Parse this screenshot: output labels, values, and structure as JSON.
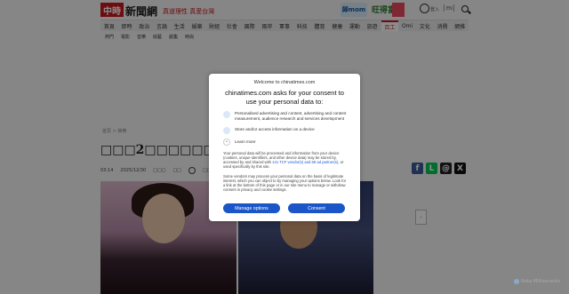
{
  "header": {
    "logo": "中時",
    "site_name": "新聞網",
    "slogan": "真道理性 真愛台灣",
    "promo_1": "歸mom",
    "promo_2": "旺得富",
    "account_label": "登入",
    "header_link": "EN"
  },
  "nav": {
    "items": [
      "首頁",
      "即時",
      "政治",
      "言論",
      "生活",
      "娛樂",
      "財經",
      "社會",
      "國際",
      "兩岸",
      "軍事",
      "科技",
      "體育",
      "健康",
      "運動",
      "旅遊",
      "百工",
      "Omi",
      "文化",
      "消費",
      "網推"
    ],
    "active_index": 16
  },
  "subnav": [
    "熱門",
    "電影",
    "音樂",
    "綜藝",
    "劇集",
    "時尚"
  ],
  "article": {
    "breadcrumb": "首頁 > 娛樂",
    "title": "□□□2□□□□□□□□ □□□□□□□□□",
    "time": "03:14",
    "date": "2025/12/30",
    "author": "□□□",
    "source": "□□",
    "listen_label": "□□□□"
  },
  "share": {
    "facebook": "f",
    "line": "L",
    "threads": "@",
    "x": "X"
  },
  "colors": {
    "brand_red": "#c8161d",
    "consent_blue": "#1a56c8"
  },
  "consent": {
    "top_label": "Welcome to chinatimes.com",
    "heading": "chinatimes.com asks for your consent to use your personal data to:",
    "purposes": [
      {
        "icon": "person-icon",
        "text": "Personalised advertising and content, advertising and content measurement, audience research and services development"
      },
      {
        "icon": "device-icon",
        "text": "Store and/or access information on a device"
      }
    ],
    "learn_more": "Learn more",
    "para_1_a": "Your personal data will be processed and information from your device (cookies, unique identifiers, and other device data) may be stored by, accessed by and shared with ",
    "para_1_link": "141 TCF vendor(s) and 69 ad partner(s)",
    "para_1_b": ", or used specifically by this site.",
    "para_2": "Some vendors may process your personal data on the basis of legitimate interest, which you can object to by managing your options below. Look for a link at the bottom of this page or in our site menu to manage or withdraw consent in privacy and cookie settings.",
    "manage_label": "Manage options",
    "consent_label": "Consent"
  },
  "watermark": "Roka Milliseconds"
}
